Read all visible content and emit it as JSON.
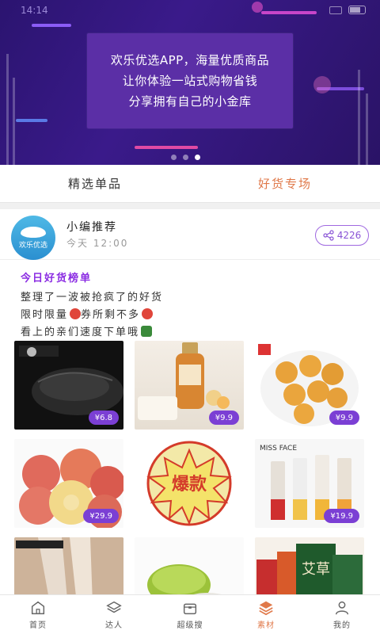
{
  "status_bar": {
    "time": "14:14",
    "network": "4G"
  },
  "banner": {
    "lines": [
      "欢乐优选APP，海量优质商品",
      "让你体验一站式购物省钱",
      "分享拥有自己的小金库"
    ],
    "pages": 3,
    "active_page": 3
  },
  "tabs": [
    {
      "label": "精选单品",
      "active": false
    },
    {
      "label": "好货专场",
      "active": true
    }
  ],
  "post": {
    "avatar_text": "欢乐优选",
    "author": "小编推荐",
    "time": "今天 12:00",
    "share_count": "4226",
    "title": "今日好货榜单",
    "lines": [
      "整理了一波被抢疯了的好货",
      "限时限量",
      "券所剩不多",
      "看上的亲们速度下单哦"
    ]
  },
  "products": [
    {
      "name": "mouse",
      "price": "¥6.8"
    },
    {
      "name": "toner",
      "price": "¥9.9"
    },
    {
      "name": "pastry",
      "price": "¥9.9"
    },
    {
      "name": "apples",
      "price": "¥29.9"
    },
    {
      "name": "hot-item",
      "badge": "爆款"
    },
    {
      "name": "missface",
      "brand": "MISS FACE",
      "price": "¥19.9"
    },
    {
      "name": "stockings"
    },
    {
      "name": "balm"
    },
    {
      "name": "aicao",
      "label": "艾草"
    }
  ],
  "bottom_nav": [
    {
      "label": "首页",
      "icon": "home-icon",
      "active": false
    },
    {
      "label": "达人",
      "icon": "layers-icon",
      "active": false
    },
    {
      "label": "超级搜",
      "icon": "box-icon",
      "active": false
    },
    {
      "label": "素材",
      "icon": "stack-icon",
      "active": true
    },
    {
      "label": "我的",
      "icon": "user-icon",
      "active": false
    }
  ],
  "colors": {
    "accent": "#e0794a",
    "purple": "#7b3fd4",
    "banner": "#2b1470",
    "card": "#5b2fa6"
  }
}
